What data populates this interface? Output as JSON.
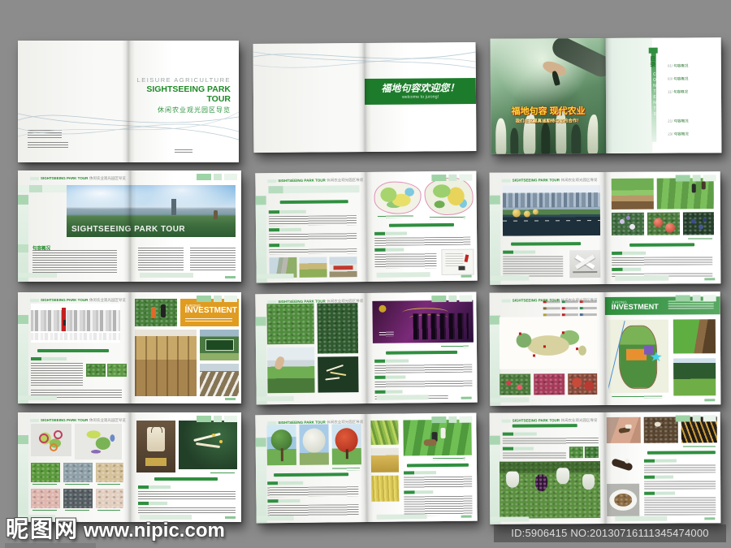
{
  "watermark": {
    "logo": "昵图网",
    "url": "www.nipic.com",
    "id_text": "ID:5906415 NO:20130716111345474000"
  },
  "brochure": {
    "header": {
      "en": "SIGHTSEEING PARK TOUR",
      "zh": "休闲农业观光园区导览"
    },
    "cover": {
      "kicker": "LEISURE  AGRICULTURE",
      "title": "SIGHTSEEING PARK TOUR",
      "subtitle": "休闲农业观光园区导览"
    },
    "welcome": {
      "title": "福地句容欢迎您！",
      "subtitle": "welcome to jurong!"
    },
    "intro": {
      "title": "福地句容  现代农业",
      "subtitle": "我们在这里真诚期待与您的合作！"
    },
    "contents": {
      "title_zh": "目录",
      "title_en": "CONTENTS",
      "items": [
        {
          "num": "01/",
          "label": "句容概况"
        },
        {
          "num": "03/",
          "label": "句容概况"
        },
        {
          "num": "11/",
          "label": "句容概况"
        },
        {
          "num": "21/",
          "label": "句容概况"
        },
        {
          "num": "23/",
          "label": "句容概况"
        }
      ]
    },
    "overview": {
      "photo_caption": "SIGHTSEEING PARK TOUR",
      "section_title": "句容概况"
    },
    "investment": {
      "word1": "JURONG",
      "word2": "INVESTMENT"
    }
  },
  "colors": {
    "brand_green": "#1f8a27",
    "banner_green": "#1d7c2b",
    "invest_orange": "#e09c20",
    "invest_band_green": "#2f8f3e",
    "page_background": "#8c8c8c"
  }
}
